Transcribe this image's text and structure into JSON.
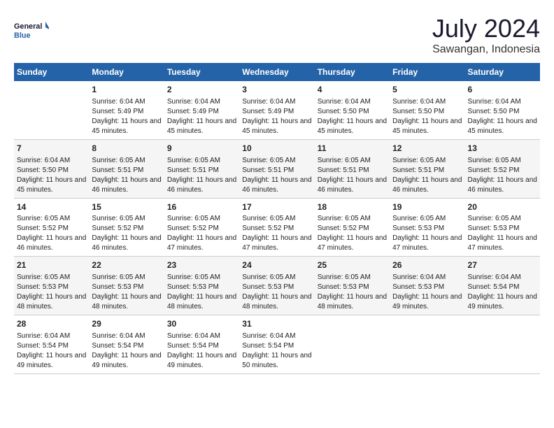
{
  "header": {
    "logo_line1": "General",
    "logo_line2": "Blue",
    "month_year": "July 2024",
    "location": "Sawangan, Indonesia"
  },
  "weekdays": [
    "Sunday",
    "Monday",
    "Tuesday",
    "Wednesday",
    "Thursday",
    "Friday",
    "Saturday"
  ],
  "weeks": [
    [
      {
        "day": "",
        "sunrise": "",
        "sunset": "",
        "daylight": ""
      },
      {
        "day": "1",
        "sunrise": "Sunrise: 6:04 AM",
        "sunset": "Sunset: 5:49 PM",
        "daylight": "Daylight: 11 hours and 45 minutes."
      },
      {
        "day": "2",
        "sunrise": "Sunrise: 6:04 AM",
        "sunset": "Sunset: 5:49 PM",
        "daylight": "Daylight: 11 hours and 45 minutes."
      },
      {
        "day": "3",
        "sunrise": "Sunrise: 6:04 AM",
        "sunset": "Sunset: 5:49 PM",
        "daylight": "Daylight: 11 hours and 45 minutes."
      },
      {
        "day": "4",
        "sunrise": "Sunrise: 6:04 AM",
        "sunset": "Sunset: 5:50 PM",
        "daylight": "Daylight: 11 hours and 45 minutes."
      },
      {
        "day": "5",
        "sunrise": "Sunrise: 6:04 AM",
        "sunset": "Sunset: 5:50 PM",
        "daylight": "Daylight: 11 hours and 45 minutes."
      },
      {
        "day": "6",
        "sunrise": "Sunrise: 6:04 AM",
        "sunset": "Sunset: 5:50 PM",
        "daylight": "Daylight: 11 hours and 45 minutes."
      }
    ],
    [
      {
        "day": "7",
        "sunrise": "Sunrise: 6:04 AM",
        "sunset": "Sunset: 5:50 PM",
        "daylight": "Daylight: 11 hours and 45 minutes."
      },
      {
        "day": "8",
        "sunrise": "Sunrise: 6:05 AM",
        "sunset": "Sunset: 5:51 PM",
        "daylight": "Daylight: 11 hours and 46 minutes."
      },
      {
        "day": "9",
        "sunrise": "Sunrise: 6:05 AM",
        "sunset": "Sunset: 5:51 PM",
        "daylight": "Daylight: 11 hours and 46 minutes."
      },
      {
        "day": "10",
        "sunrise": "Sunrise: 6:05 AM",
        "sunset": "Sunset: 5:51 PM",
        "daylight": "Daylight: 11 hours and 46 minutes."
      },
      {
        "day": "11",
        "sunrise": "Sunrise: 6:05 AM",
        "sunset": "Sunset: 5:51 PM",
        "daylight": "Daylight: 11 hours and 46 minutes."
      },
      {
        "day": "12",
        "sunrise": "Sunrise: 6:05 AM",
        "sunset": "Sunset: 5:51 PM",
        "daylight": "Daylight: 11 hours and 46 minutes."
      },
      {
        "day": "13",
        "sunrise": "Sunrise: 6:05 AM",
        "sunset": "Sunset: 5:52 PM",
        "daylight": "Daylight: 11 hours and 46 minutes."
      }
    ],
    [
      {
        "day": "14",
        "sunrise": "Sunrise: 6:05 AM",
        "sunset": "Sunset: 5:52 PM",
        "daylight": "Daylight: 11 hours and 46 minutes."
      },
      {
        "day": "15",
        "sunrise": "Sunrise: 6:05 AM",
        "sunset": "Sunset: 5:52 PM",
        "daylight": "Daylight: 11 hours and 46 minutes."
      },
      {
        "day": "16",
        "sunrise": "Sunrise: 6:05 AM",
        "sunset": "Sunset: 5:52 PM",
        "daylight": "Daylight: 11 hours and 47 minutes."
      },
      {
        "day": "17",
        "sunrise": "Sunrise: 6:05 AM",
        "sunset": "Sunset: 5:52 PM",
        "daylight": "Daylight: 11 hours and 47 minutes."
      },
      {
        "day": "18",
        "sunrise": "Sunrise: 6:05 AM",
        "sunset": "Sunset: 5:52 PM",
        "daylight": "Daylight: 11 hours and 47 minutes."
      },
      {
        "day": "19",
        "sunrise": "Sunrise: 6:05 AM",
        "sunset": "Sunset: 5:53 PM",
        "daylight": "Daylight: 11 hours and 47 minutes."
      },
      {
        "day": "20",
        "sunrise": "Sunrise: 6:05 AM",
        "sunset": "Sunset: 5:53 PM",
        "daylight": "Daylight: 11 hours and 47 minutes."
      }
    ],
    [
      {
        "day": "21",
        "sunrise": "Sunrise: 6:05 AM",
        "sunset": "Sunset: 5:53 PM",
        "daylight": "Daylight: 11 hours and 48 minutes."
      },
      {
        "day": "22",
        "sunrise": "Sunrise: 6:05 AM",
        "sunset": "Sunset: 5:53 PM",
        "daylight": "Daylight: 11 hours and 48 minutes."
      },
      {
        "day": "23",
        "sunrise": "Sunrise: 6:05 AM",
        "sunset": "Sunset: 5:53 PM",
        "daylight": "Daylight: 11 hours and 48 minutes."
      },
      {
        "day": "24",
        "sunrise": "Sunrise: 6:05 AM",
        "sunset": "Sunset: 5:53 PM",
        "daylight": "Daylight: 11 hours and 48 minutes."
      },
      {
        "day": "25",
        "sunrise": "Sunrise: 6:05 AM",
        "sunset": "Sunset: 5:53 PM",
        "daylight": "Daylight: 11 hours and 48 minutes."
      },
      {
        "day": "26",
        "sunrise": "Sunrise: 6:04 AM",
        "sunset": "Sunset: 5:53 PM",
        "daylight": "Daylight: 11 hours and 49 minutes."
      },
      {
        "day": "27",
        "sunrise": "Sunrise: 6:04 AM",
        "sunset": "Sunset: 5:54 PM",
        "daylight": "Daylight: 11 hours and 49 minutes."
      }
    ],
    [
      {
        "day": "28",
        "sunrise": "Sunrise: 6:04 AM",
        "sunset": "Sunset: 5:54 PM",
        "daylight": "Daylight: 11 hours and 49 minutes."
      },
      {
        "day": "29",
        "sunrise": "Sunrise: 6:04 AM",
        "sunset": "Sunset: 5:54 PM",
        "daylight": "Daylight: 11 hours and 49 minutes."
      },
      {
        "day": "30",
        "sunrise": "Sunrise: 6:04 AM",
        "sunset": "Sunset: 5:54 PM",
        "daylight": "Daylight: 11 hours and 49 minutes."
      },
      {
        "day": "31",
        "sunrise": "Sunrise: 6:04 AM",
        "sunset": "Sunset: 5:54 PM",
        "daylight": "Daylight: 11 hours and 50 minutes."
      },
      {
        "day": "",
        "sunrise": "",
        "sunset": "",
        "daylight": ""
      },
      {
        "day": "",
        "sunrise": "",
        "sunset": "",
        "daylight": ""
      },
      {
        "day": "",
        "sunrise": "",
        "sunset": "",
        "daylight": ""
      }
    ]
  ]
}
